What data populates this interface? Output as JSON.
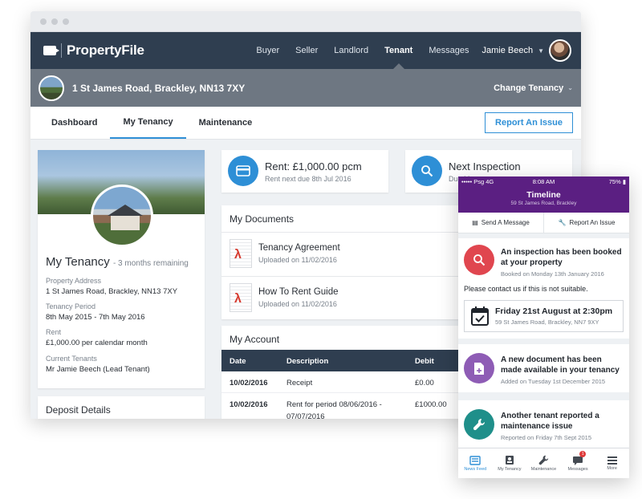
{
  "app": {
    "brand": "PropertyFile",
    "nav": [
      "Buyer",
      "Seller",
      "Landlord",
      "Tenant",
      "Messages"
    ],
    "active_nav": "Tenant",
    "user_name": "Jamie Beech"
  },
  "property_bar": {
    "address": "1 St James Road, Brackley, NN13 7XY",
    "change_label": "Change Tenancy"
  },
  "subtabs": [
    "Dashboard",
    "My Tenancy",
    "Maintenance"
  ],
  "report_button": "Report An Issue",
  "tenancy": {
    "title": "My Tenancy",
    "remaining": "- 3 months remaining",
    "fields": [
      {
        "label": "Property Address",
        "value": "1 St James Road, Brackley, NN13 7XY"
      },
      {
        "label": "Tenancy Period",
        "value": "8th May 2015 - 7th May 2016"
      },
      {
        "label": "Rent",
        "value": "£1,000.00 per calendar month"
      },
      {
        "label": "Current Tenants",
        "value": "Mr Jamie Beech (Lead Tenant)"
      }
    ]
  },
  "deposit": {
    "title": "Deposit Details"
  },
  "rent": {
    "title": "Rent: £1,000.00 pcm",
    "sub": "Rent next due 8th Jul 2016"
  },
  "inspection": {
    "title": "Next Inspection",
    "sub": "Due M"
  },
  "documents": {
    "title": "My Documents",
    "items": [
      {
        "name": "Tenancy Agreement",
        "date": "Uploaded on 11/02/2016"
      },
      {
        "name": "How To Rent Guide",
        "date": "Uploaded on 11/02/2016"
      }
    ]
  },
  "account": {
    "title": "My Account",
    "columns": [
      "Date",
      "Description",
      "Debit"
    ],
    "rows": [
      {
        "date": "10/02/2016",
        "description": "Receipt",
        "debit": "£0.00"
      },
      {
        "date": "10/02/2016",
        "description": "Rent for period 08/06/2016 -",
        "description2": "07/07/2016",
        "debit": "£1000.00"
      }
    ]
  },
  "phone": {
    "status": {
      "carrier": "Psg 4G",
      "time": "8:08 AM",
      "battery": "75%"
    },
    "title": "Timeline",
    "subtitle": "59 St James Road, Brackley",
    "actions": [
      "Send A Message",
      "Report An Issue"
    ],
    "feed": [
      {
        "title": "An inspection has been booked at your property",
        "date": "Booked on Monday 13th January 2016",
        "note": "Please contact us if this is not suitable.",
        "event_title": "Friday 21st August at 2:30pm",
        "event_sub": "59 St James Road, Brackley, NN7 9XY",
        "color": "#e0464f"
      },
      {
        "title": "A new document has been made available in your tenancy",
        "date": "Added on Tuesday 1st December 2015",
        "color": "#8e5cb5"
      },
      {
        "title": "Another tenant reported a maintenance issue",
        "date": "Reported on Friday 7th Sept 2015",
        "color": "#1f8f8a"
      }
    ],
    "tabs": [
      "News Feed",
      "My Tenancy",
      "Maintenance",
      "Messages",
      "More"
    ],
    "messages_badge": "1"
  }
}
